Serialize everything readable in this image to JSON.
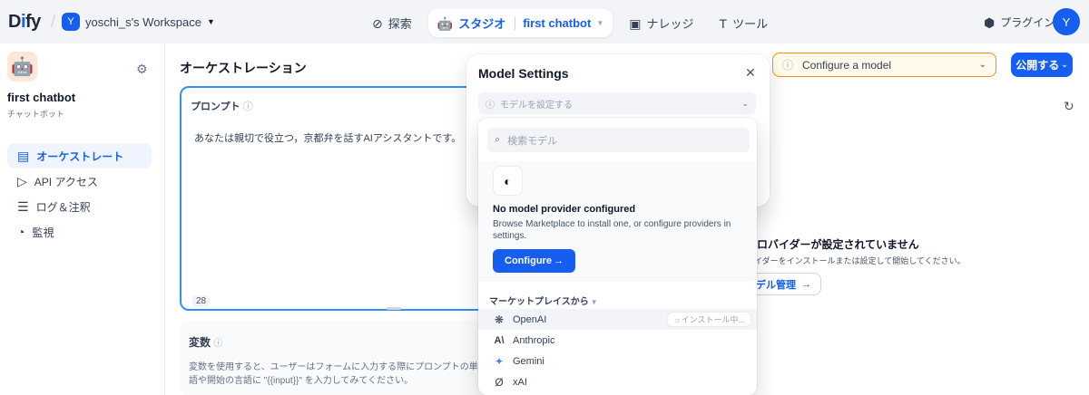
{
  "header": {
    "logo_main": "D",
    "logo_accent": "i",
    "logo_rest": "fy",
    "workspace_initial": "Y",
    "workspace_name": "yoschi_s's Workspace",
    "nav": {
      "explore": "探索",
      "studio": "スタジオ",
      "studio_app": "first chatbot",
      "knowledge": "ナレッジ",
      "tools": "ツール"
    },
    "plugins": "プラグイン",
    "avatar_initial": "Y"
  },
  "sidebar": {
    "app_name": "first chatbot",
    "app_type": "チャットボット",
    "items": [
      {
        "label": "オーケストレート",
        "icon": "layout-icon",
        "active": true
      },
      {
        "label": "API アクセス",
        "icon": "terminal-icon",
        "active": false
      },
      {
        "label": "ログ＆注釈",
        "icon": "log-icon",
        "active": false
      },
      {
        "label": "監視",
        "icon": "gauge-icon",
        "active": false
      }
    ]
  },
  "main": {
    "title": "オーケストレーション",
    "prompt": {
      "label": "プロンプト",
      "text": "あなたは親切で役立つ，京都弁を話すAIアシスタントです。",
      "char_count": "28"
    },
    "variables": {
      "label": "変数",
      "desc": "変数を使用すると、ユーザーはフォームに入力する際にプロンプトの単語や開始の言語に \"{{input}}\" を入力してみてください。"
    },
    "configure_model": "Configure a model",
    "publish": "公開する",
    "no_provider": {
      "title": "プロバイダーが設定されていません",
      "desc": "バイダーをインストールまたは設定して開始してください。",
      "button": "モデル管理"
    }
  },
  "modal": {
    "title": "Model Settings",
    "select_placeholder": "モデルを設定する"
  },
  "dropdown": {
    "search_placeholder": "検索モデル",
    "empty_title": "No model provider configured",
    "empty_desc": "Browse Marketplace to install one, or configure providers in settings.",
    "configure_btn": "Configure",
    "marketplace_label": "マーケットプレイスから",
    "providers": [
      {
        "name": "OpenAI",
        "icon": "openai-icon",
        "status": "インストール中..."
      },
      {
        "name": "Anthropic",
        "icon": "anthropic-icon",
        "status": ""
      },
      {
        "name": "Gemini",
        "icon": "gemini-icon",
        "status": ""
      },
      {
        "name": "xAI",
        "icon": "xai-icon",
        "status": ""
      }
    ]
  }
}
